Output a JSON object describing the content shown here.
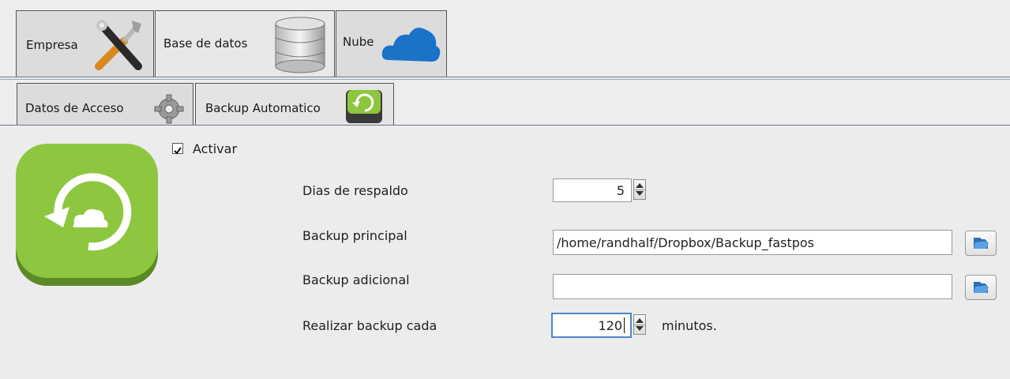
{
  "top_tabs": [
    {
      "label": "Empresa",
      "icon": "tools-icon"
    },
    {
      "label": "Base de datos",
      "icon": "database-icon"
    },
    {
      "label": "Nube",
      "icon": "cloud-icon"
    }
  ],
  "sub_tabs": [
    {
      "label": "Datos de Acceso",
      "icon": "gear-icon"
    },
    {
      "label": "Backup Automatico",
      "icon": "backup-drive-icon"
    }
  ],
  "form": {
    "activar_label": "Activar",
    "activar_checked": true,
    "dias_label": "Dias de respaldo",
    "dias_value": "5",
    "principal_label": "Backup principal",
    "principal_value": "/home/randhalf/Dropbox/Backup_fastpos",
    "adicional_label": "Backup adicional",
    "adicional_value": "",
    "cada_label": "Realizar backup cada",
    "cada_value": "120",
    "cada_unit": "minutos."
  },
  "colors": {
    "accent_green": "#8dc63f",
    "cloud_blue": "#1a73c9"
  }
}
